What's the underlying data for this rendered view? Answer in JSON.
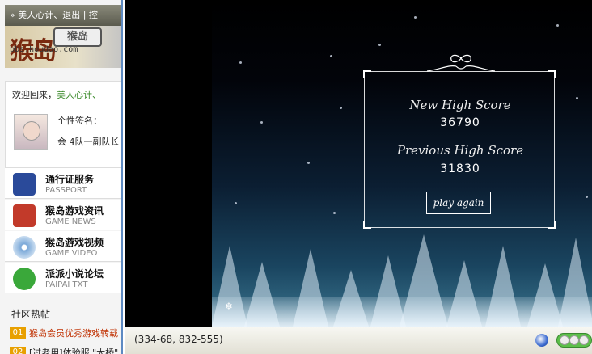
{
  "site": {
    "topbar_text": "» 美人心计、退出 | 控",
    "logo_url": "bbs.houdao.com",
    "welcome_prefix": "欢迎回来，",
    "welcome_user": "美人心计、",
    "signature_title": "个性签名：",
    "signature_text": "会 4队一副队长",
    "services": [
      {
        "title": "通行证服务",
        "subtitle": "PASSPORT",
        "icon": "passport-icon",
        "color": "#2a4a9a"
      },
      {
        "title": "猴岛游戏资讯",
        "subtitle": "GAME NEWS",
        "icon": "news-icon",
        "color": "#c23a2a"
      },
      {
        "title": "猴岛游戏视频",
        "subtitle": "GAME VIDEO",
        "icon": "disc-icon",
        "color": "#7aa8d8"
      },
      {
        "title": "派派小说论坛",
        "subtitle": "PAIPAI TXT",
        "icon": "chat-icon",
        "color": "#3aa83a"
      }
    ],
    "hot_title": "社区热帖",
    "hot_posts": [
      {
        "num": "01",
        "text": "猴岛会员优秀游戏转载"
      },
      {
        "num": "02",
        "text": "[过老用]体验服 \"大桥\" 更新、吃"
      }
    ]
  },
  "game": {
    "new_high_score_label": "New High Score",
    "new_high_score": "36790",
    "previous_high_score_label": "Previous High Score",
    "previous_high_score": "31830",
    "play_again_label": "play again"
  },
  "statusbar": {
    "coords": "(334-68, 832-555)"
  },
  "colors": {
    "accent_border": "#5d8ac2",
    "hot_badge": "#e8a000"
  }
}
